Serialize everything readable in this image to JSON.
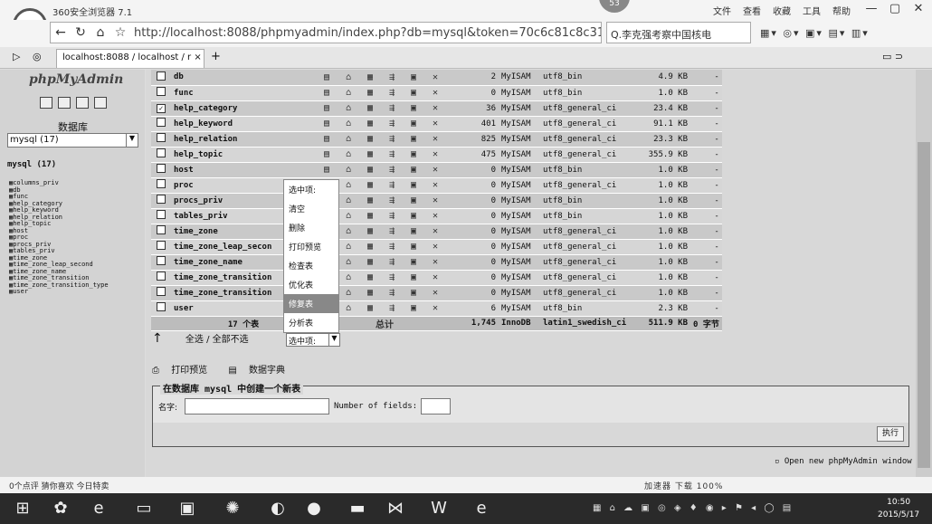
{
  "browser": {
    "title": "360安全浏览器 7.1",
    "badge": "53",
    "menu": [
      "文件",
      "查看",
      "收藏",
      "工具",
      "帮助"
    ],
    "url": "http://localhost:8088/phpmyadmin/index.php?db=mysql&token=70c6c81c8c31",
    "search_placeholder": "Q.李克强考察中国核电",
    "tab_label": "localhost:8088 / localhost / r",
    "tab_close": "×",
    "new_tab": "+"
  },
  "sidebar": {
    "logo": "phpMyAdmin",
    "db_label": "数据库",
    "db_select": "mysql (17)",
    "db_name": "mysql (17)",
    "tables": [
      "columns_priv",
      "db",
      "func",
      "help_category",
      "help_keyword",
      "help_relation",
      "help_topic",
      "host",
      "proc",
      "procs_priv",
      "tables_priv",
      "time_zone",
      "time_zone_leap_second",
      "time_zone_name",
      "time_zone_transition",
      "time_zone_transition_type",
      "user"
    ]
  },
  "table": {
    "rows": [
      {
        "name": "db",
        "rows": "2",
        "engine": "MyISAM",
        "collation": "utf8_bin",
        "size": "4.9 KB",
        "overhead": "-",
        "checked": false
      },
      {
        "name": "func",
        "rows": "0",
        "engine": "MyISAM",
        "collation": "utf8_bin",
        "size": "1.0 KB",
        "overhead": "-",
        "checked": false
      },
      {
        "name": "help_category",
        "rows": "36",
        "engine": "MyISAM",
        "collation": "utf8_general_ci",
        "size": "23.4 KB",
        "overhead": "-",
        "checked": true
      },
      {
        "name": "help_keyword",
        "rows": "401",
        "engine": "MyISAM",
        "collation": "utf8_general_ci",
        "size": "91.1 KB",
        "overhead": "-",
        "checked": false
      },
      {
        "name": "help_relation",
        "rows": "825",
        "engine": "MyISAM",
        "collation": "utf8_general_ci",
        "size": "23.3 KB",
        "overhead": "-",
        "checked": false
      },
      {
        "name": "help_topic",
        "rows": "475",
        "engine": "MyISAM",
        "collation": "utf8_general_ci",
        "size": "355.9 KB",
        "overhead": "-",
        "checked": false
      },
      {
        "name": "host",
        "rows": "0",
        "engine": "MyISAM",
        "collation": "utf8_bin",
        "size": "1.0 KB",
        "overhead": "-",
        "checked": false
      },
      {
        "name": "proc",
        "rows": "0",
        "engine": "MyISAM",
        "collation": "utf8_general_ci",
        "size": "1.0 KB",
        "overhead": "-",
        "checked": false
      },
      {
        "name": "procs_priv",
        "rows": "0",
        "engine": "MyISAM",
        "collation": "utf8_bin",
        "size": "1.0 KB",
        "overhead": "-",
        "checked": false
      },
      {
        "name": "tables_priv",
        "rows": "0",
        "engine": "MyISAM",
        "collation": "utf8_bin",
        "size": "1.0 KB",
        "overhead": "-",
        "checked": false
      },
      {
        "name": "time_zone",
        "rows": "0",
        "engine": "MyISAM",
        "collation": "utf8_general_ci",
        "size": "1.0 KB",
        "overhead": "-",
        "checked": false
      },
      {
        "name": "time_zone_leap_secon",
        "rows": "0",
        "engine": "MyISAM",
        "collation": "utf8_general_ci",
        "size": "1.0 KB",
        "overhead": "-",
        "checked": false
      },
      {
        "name": "time_zone_name",
        "rows": "0",
        "engine": "MyISAM",
        "collation": "utf8_general_ci",
        "size": "1.0 KB",
        "overhead": "-",
        "checked": false
      },
      {
        "name": "time_zone_transition",
        "rows": "0",
        "engine": "MyISAM",
        "collation": "utf8_general_ci",
        "size": "1.0 KB",
        "overhead": "-",
        "checked": false
      },
      {
        "name": "time_zone_transition",
        "rows": "0",
        "engine": "MyISAM",
        "collation": "utf8_general_ci",
        "size": "1.0 KB",
        "overhead": "-",
        "checked": false
      },
      {
        "name": "user",
        "rows": "6",
        "engine": "MyISAM",
        "collation": "utf8_bin",
        "size": "2.3 KB",
        "overhead": "-",
        "checked": false
      }
    ],
    "summary": {
      "count": "17 个表",
      "label": "总计",
      "rows": "1,745",
      "engine": "InnoDB",
      "collation": "latin1_swedish_ci",
      "size": "511.9 KB",
      "overhead": "0 字节"
    }
  },
  "context_menu": [
    "选中项:",
    "清空",
    "删除",
    "打印预览",
    "检查表",
    "优化表",
    "修复表",
    "分析表"
  ],
  "bottom": {
    "select_all": "全选 / 全部不选",
    "with_selected": "选中项:",
    "print_view": "打印预览",
    "data_dict": "数据字典",
    "create_legend": "在数据库 mysql 中创建一个新表",
    "name_label": "名字:",
    "fields_label": "Number of fields:",
    "go": "执行",
    "new_window": "Open new phpMyAdmin window"
  },
  "status": {
    "left": "0个点评   猜你喜欢   今日特卖",
    "right": "加速器  下载  100%"
  },
  "clock": {
    "time": "10:50",
    "date": "2015/5/17"
  }
}
